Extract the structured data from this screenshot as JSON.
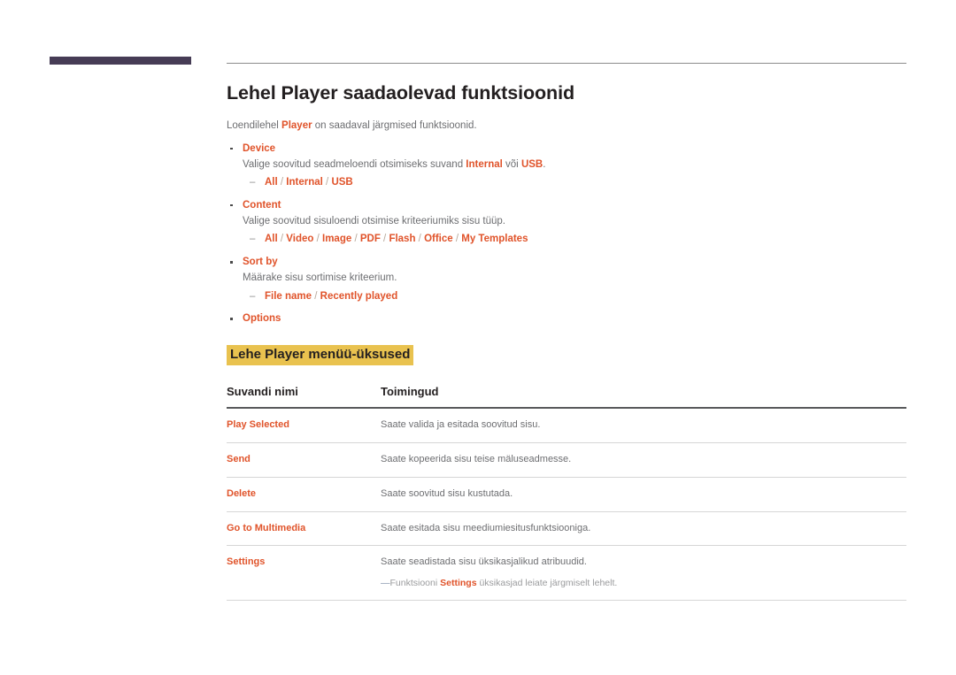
{
  "page": {
    "title": "Lehel Player saadaolevad funktsioonid",
    "intro_pre": "Loendilehel ",
    "intro_term": "Player",
    "intro_post": " on saadaval järgmised funktsioonid."
  },
  "bullets": [
    {
      "label": "Device",
      "desc_pre": "Valige soovitud seadmeloendi otsimiseks suvand ",
      "desc_term1": "Internal",
      "desc_mid": " või ",
      "desc_term2": "USB",
      "desc_post": ".",
      "options": "All / Internal / USB"
    },
    {
      "label": "Content",
      "desc_pre": "Valige soovitud sisuloendi otsimise kriteeriumiks sisu tüüp.",
      "options": "All / Video / Image / PDF / Flash / Office / My Templates"
    },
    {
      "label": "Sort by",
      "desc_pre": "Määrake sisu sortimise kriteerium.",
      "options": "File name / Recently played"
    },
    {
      "label": "Options"
    }
  ],
  "subtitle": "Lehe Player menüü-üksused",
  "table": {
    "headers": [
      "Suvandi nimi",
      "Toimingud"
    ],
    "rows": [
      {
        "name": "Play Selected",
        "desc": "Saate valida ja esitada soovitud sisu."
      },
      {
        "name": "Send",
        "desc": "Saate kopeerida sisu teise mäluseadmesse."
      },
      {
        "name": "Delete",
        "desc": "Saate soovitud sisu kustutada."
      },
      {
        "name": "Go to Multimedia",
        "desc": "Saate esitada sisu meediumiesitusfunktsiooniga."
      },
      {
        "name": "Settings",
        "desc": "Saate seadistada sisu üksikasjalikud atribuudid.",
        "note_pre": "Funktsiooni ",
        "note_term": "Settings",
        "note_post": " üksikasjad leiate järgmiselt lehelt."
      }
    ]
  },
  "colors": {
    "accent_orange": "#e0532a",
    "highlight_gold": "#e9c24f",
    "corner_bar": "#463c55",
    "body_gray": "#6d6e71",
    "heading_black": "#231f20"
  }
}
